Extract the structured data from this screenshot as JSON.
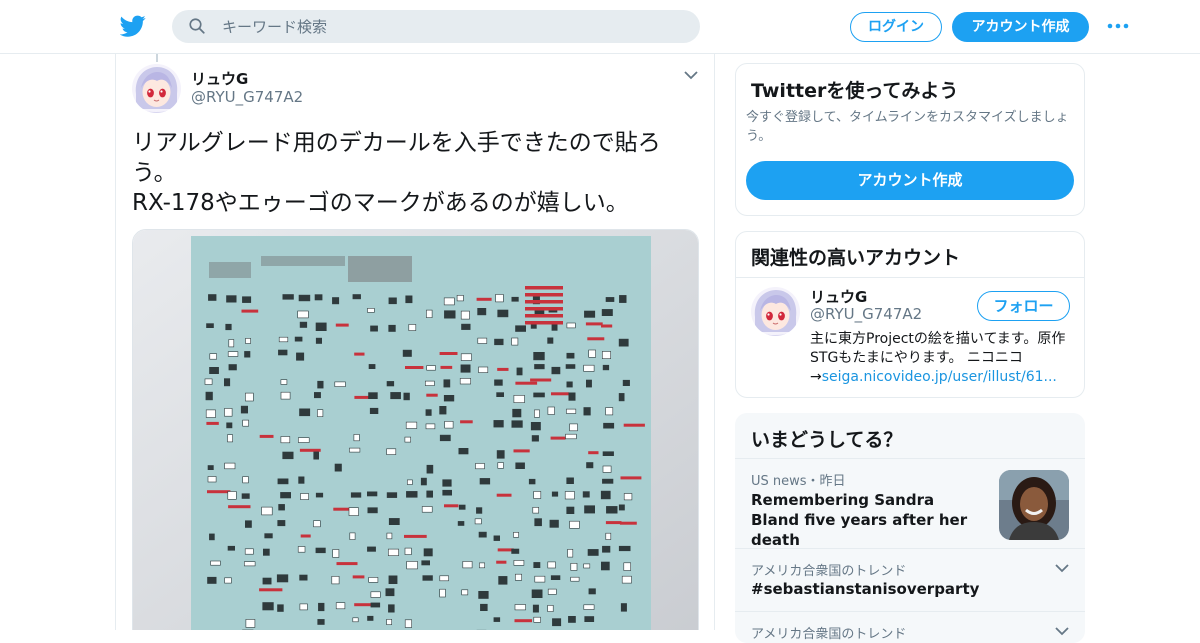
{
  "nav": {
    "search_placeholder": "キーワード検索",
    "login_label": "ログイン",
    "signup_label": "アカウント作成",
    "logo_icon": "twitter-bird-icon",
    "more_icon": "more-dots-icon",
    "brand_color": "#1da1f2"
  },
  "tweet": {
    "author_name": "リュウG",
    "author_handle": "@RYU_G747A2",
    "text_line1": "リアルグレード用のデカールを入手できたので貼ろう。",
    "text_line2": "RX-178やエゥーゴのマークがあるのが嬉しい。"
  },
  "sidebar": {
    "signup_card": {
      "title": "Twitterを使ってみよう",
      "description": "今すぐ登録して、タイムラインをカスタマイズしましょう。",
      "button_label": "アカウント作成"
    },
    "related": {
      "title": "関連性の高いアカウント",
      "name": "リュウG",
      "handle": "@RYU_G747A2",
      "follow_label": "フォロー",
      "bio_text": "主に東方Projectの絵を描いてます。原作STGもたまにやります。 ニコニコ→",
      "bio_link": "seiga.nicovideo.jp/user/illust/61..."
    },
    "trends": {
      "title": "いまどうしてる？",
      "news_meta": "US news・昨日",
      "news_title": "Remembering Sandra Bland five years after her death",
      "trend1_meta": "アメリカ合衆国のトレンド",
      "trend1_title": "#sebastianstanisoverparty",
      "trend2_meta": "アメリカ合衆国のトレンド"
    }
  }
}
